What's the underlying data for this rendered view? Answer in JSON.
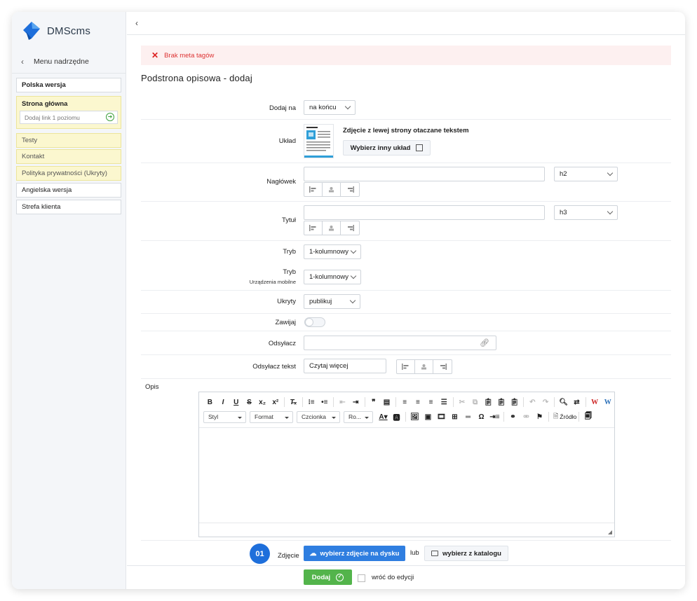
{
  "app": {
    "name": "DMScms"
  },
  "sidebar": {
    "back_label": "Menu nadrzędne",
    "items": [
      {
        "label": "Polska wersja"
      },
      {
        "label": "Strona główna"
      },
      {
        "label": "Dodaj link 1 poziomu"
      },
      {
        "label": "Testy"
      },
      {
        "label": "Kontakt"
      },
      {
        "label": "Polityka prywatności (Ukryty)"
      },
      {
        "label": "Angielska wersja"
      },
      {
        "label": "Strefa klienta"
      }
    ]
  },
  "alert": {
    "text": "Brak meta tagów",
    "color": "#dd3333"
  },
  "page": {
    "title": "Podstrona opisowa - dodaj"
  },
  "form": {
    "dodaj_na": {
      "label": "Dodaj na",
      "value": "na końcu"
    },
    "uklad": {
      "label": "Układ",
      "name": "Zdjęcie z lewej strony otaczane tekstem",
      "button": "Wybierz inny układ"
    },
    "naglowek": {
      "label": "Nagłówek",
      "value": "",
      "level": "h2"
    },
    "tytul": {
      "label": "Tytuł",
      "value": "",
      "level": "h3"
    },
    "tryb": {
      "label": "Tryb",
      "value": "1-kolumnowy"
    },
    "tryb_mobile": {
      "label": "Tryb",
      "sublabel": "Urządzenia mobilne",
      "value": "1-kolumnowy"
    },
    "ukryty": {
      "label": "Ukryty",
      "value": "publikuj"
    },
    "zawijaj": {
      "label": "Zawijaj"
    },
    "odsylacz": {
      "label": "Odsyłacz",
      "value": ""
    },
    "odsylacz_tekst": {
      "label": "Odsyłacz tekst",
      "value": "Czytaj więcej"
    },
    "opis": {
      "label": "Opis"
    }
  },
  "editor": {
    "combos": [
      "Styl",
      "Format",
      "Czcionka",
      "Ro..."
    ],
    "source_label": "Źródło"
  },
  "photo": {
    "badge": "01",
    "label": "Zdjęcie",
    "upload_button": "wybierz zdjęcie na dysku",
    "or": "lub",
    "catalog_button": "wybierz z katalogu"
  },
  "footer": {
    "submit": "Dodaj",
    "return_label": "wróć do edycji"
  },
  "colors": {
    "primary": "#2f7ee0",
    "success": "#53b44b",
    "badge": "#1e6fdb",
    "highlight": "#fbf7cf"
  }
}
